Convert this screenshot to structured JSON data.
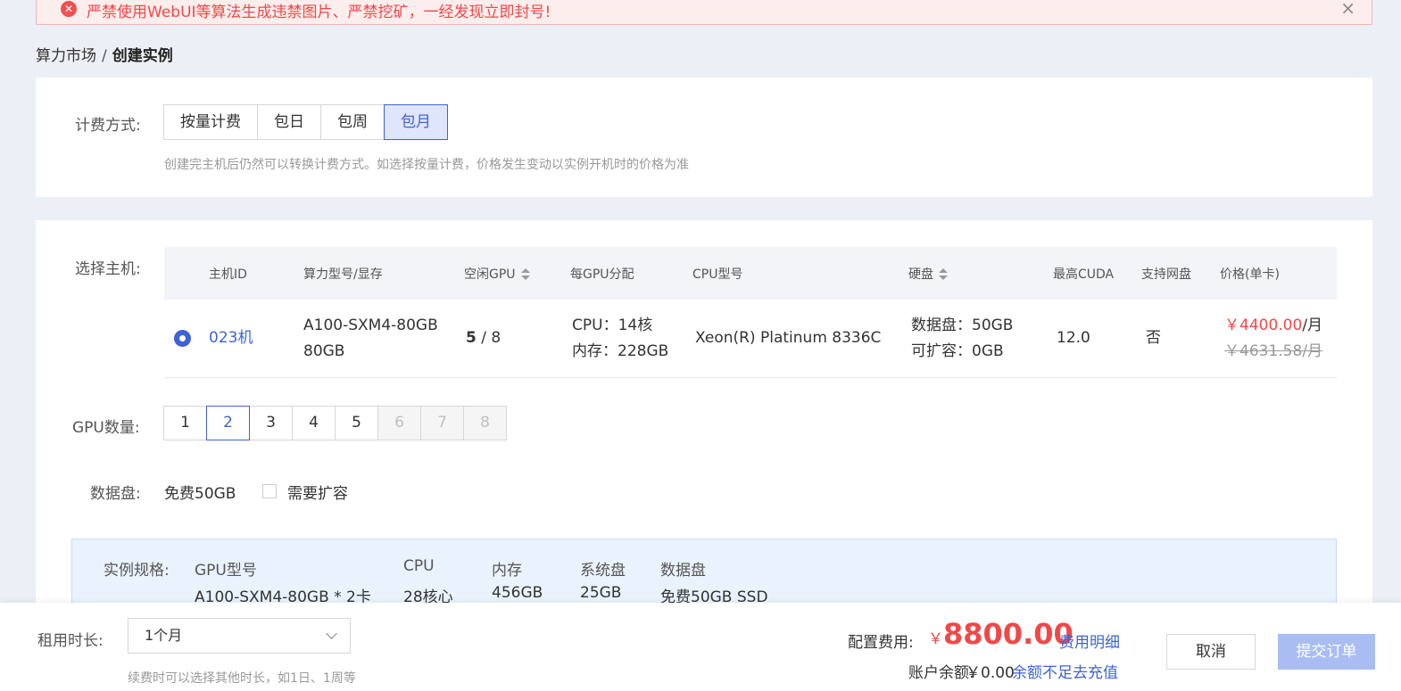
{
  "alert": {
    "message": "严禁使用WebUI等算法生成违禁图片、严禁挖矿，一经发现立即封号!",
    "close_glyph": "×"
  },
  "breadcrumb": {
    "parent": "算力市场",
    "separator": "/",
    "current": "创建实例"
  },
  "billing": {
    "label": "计费方式:",
    "options": [
      "按量计费",
      "包日",
      "包周",
      "包月"
    ],
    "selected": "包月",
    "hint": "创建完主机后仍然可以转换计费方式。如选择按量计费，价格发生变动以实例开机时的价格为准"
  },
  "host": {
    "label": "选择主机:",
    "columns": {
      "id": "主机ID",
      "model": "算力型号/显存",
      "idle_gpu": "空闲GPU",
      "per_gpu": "每GPU分配",
      "cpu_model": "CPU型号",
      "disk": "硬盘",
      "cuda": "最高CUDA",
      "netdisk": "支持网盘",
      "price": "价格(单卡)"
    },
    "row": {
      "id": "023机",
      "model": "A100-SXM4-80GB",
      "vram": "80GB",
      "idle": "5",
      "idle_sep": " / ",
      "total": "8",
      "cpu_alloc": "CPU：14核",
      "mem_alloc": "内存：228GB",
      "cpu_model": "Xeon(R) Platinum 8336C",
      "data_disk": "数据盘：50GB",
      "expandable": "可扩容：0GB",
      "cuda": "12.0",
      "netdisk": "否",
      "price_now": "￥4400.00",
      "price_unit": "/月",
      "price_old": "￥4631.58/月"
    }
  },
  "gpu_count": {
    "label": "GPU数量:",
    "options": [
      "1",
      "2",
      "3",
      "4",
      "5",
      "6",
      "7",
      "8"
    ],
    "selected": "2",
    "available_max": 5
  },
  "data_disk": {
    "label": "数据盘:",
    "free": "免费50GB",
    "expand_label": "需要扩容",
    "expand_checked": false
  },
  "spec": {
    "label": "实例规格:",
    "headers": [
      "GPU型号",
      "CPU",
      "内存",
      "系统盘",
      "数据盘"
    ],
    "values": [
      "A100-SXM4-80GB * 2卡",
      "28核心",
      "456GB",
      "25GB",
      "免费50GB SSD"
    ]
  },
  "footer": {
    "duration_label": "租用时长:",
    "duration_value": "1个月",
    "duration_hint": "续费时可以选择其他时长，如1日、1周等",
    "fee_label": "配置费用:",
    "fee_currency": "￥",
    "fee_amount": "8800.00",
    "fee_detail": "费用明细",
    "balance_label": "账户余额:",
    "balance_value": "￥0.00",
    "recharge": "余额不足去充值",
    "cancel": "取消",
    "submit": "提交订单"
  },
  "colors": {
    "accent": "#3f63d4",
    "danger": "#f04848",
    "submit_disabled": "#a9bdf3"
  }
}
